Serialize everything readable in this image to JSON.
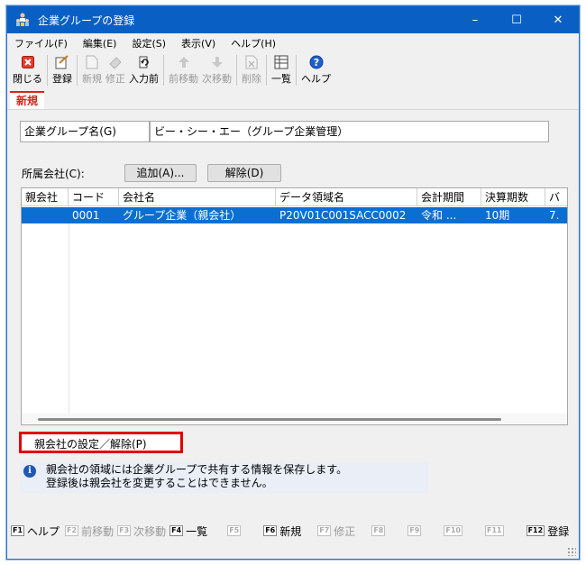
{
  "window": {
    "title": "企業グループの登録",
    "controls": {
      "minimize": "–",
      "maximize": "☐",
      "close": "✕"
    }
  },
  "menu": [
    "ファイル(F)",
    "編集(E)",
    "設定(S)",
    "表示(V)",
    "ヘルプ(H)"
  ],
  "toolbar": {
    "close": "閉じる",
    "register": "登録",
    "new": "新規",
    "modify": "修正",
    "pre_input": "入力前",
    "prev": "前移動",
    "next": "次移動",
    "delete": "削除",
    "list": "一覧",
    "help": "ヘルプ"
  },
  "mode_tab": "新規",
  "form": {
    "group_name_label": "企業グループ名(G)",
    "group_name_value": "ビー・シー・エー（グループ企業管理）",
    "member_label": "所属会社(C):",
    "add_button": "追加(A)...",
    "remove_button": "解除(D)"
  },
  "table": {
    "headers": [
      "親会社",
      "コード",
      "会社名",
      "データ領域名",
      "会計期間",
      "決算期数",
      "バ"
    ],
    "rows": [
      [
        "",
        "0001",
        "グループ企業（親会社）",
        "P20V01C001SACC0002",
        "令和 ...",
        "10期",
        "7."
      ]
    ]
  },
  "parent_button": "親会社の設定／解除(P)",
  "info": {
    "line1": "親会社の領域には企業グループで共有する情報を保存します。",
    "line2": "登録後は親会社を変更することはできません。"
  },
  "fkeys": [
    {
      "key": "F1",
      "label": "ヘルプ",
      "enabled": true
    },
    {
      "key": "F2",
      "label": "前移動",
      "enabled": false
    },
    {
      "key": "F3",
      "label": "次移動",
      "enabled": false
    },
    {
      "key": "F4",
      "label": "一覧",
      "enabled": true
    },
    {
      "key": "F5",
      "label": "",
      "enabled": false
    },
    {
      "key": "F6",
      "label": "新規",
      "enabled": true
    },
    {
      "key": "F7",
      "label": "修正",
      "enabled": false
    },
    {
      "key": "F8",
      "label": "",
      "enabled": false
    },
    {
      "key": "F9",
      "label": "",
      "enabled": false
    },
    {
      "key": "F10",
      "label": "",
      "enabled": false
    },
    {
      "key": "F11",
      "label": "",
      "enabled": false
    },
    {
      "key": "F12",
      "label": "登録",
      "enabled": true
    }
  ],
  "colors": {
    "titlebar": "#0a5fc5",
    "selection": "#0a6fd1",
    "mode_tab": "#d9241b",
    "highlight": "#e00000"
  }
}
